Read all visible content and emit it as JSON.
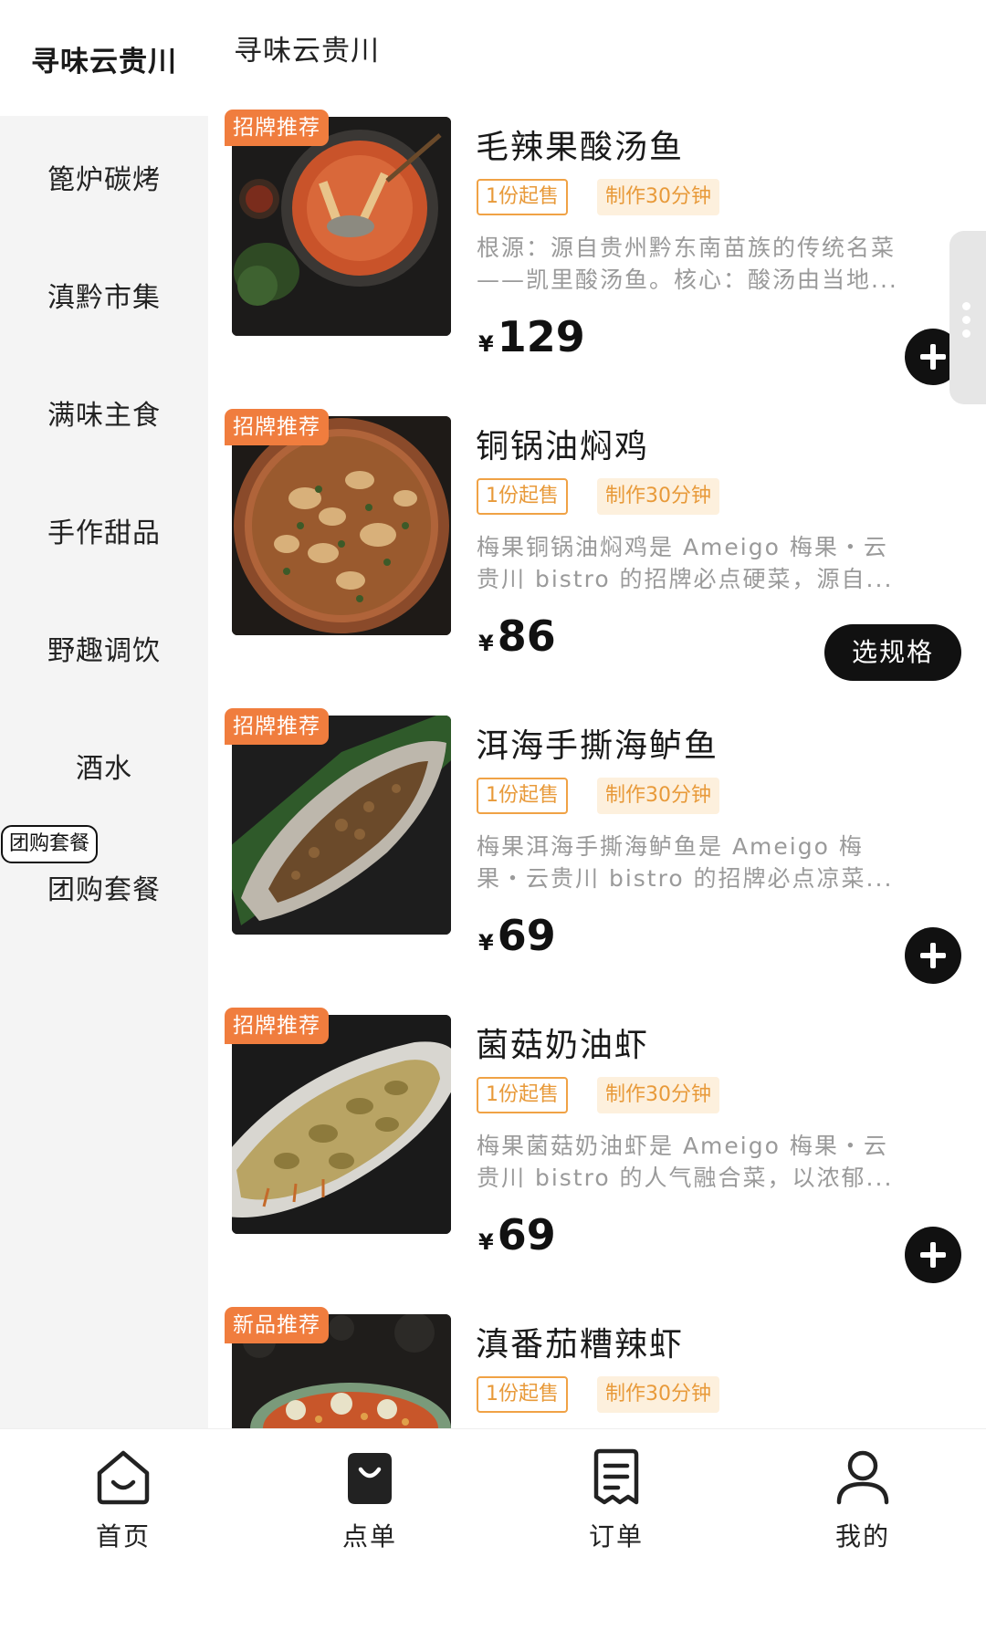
{
  "sidebar": {
    "active_category": "寻味云贵川",
    "categories": [
      "篦炉碳烤",
      "滇黔市集",
      "满味主食",
      "手作甜品",
      "野趣调饮",
      "酒水",
      "团购套餐"
    ],
    "tooltip_label": "团购套餐"
  },
  "section": {
    "title": "寻味云贵川"
  },
  "products": [
    {
      "badge": "招牌推荐",
      "name": "毛辣果酸汤鱼",
      "min_tag": "1份起售",
      "time_tag": "制作30分钟",
      "desc_line1": "根源：源自贵州黔东南苗族的传统名菜",
      "desc_line2": "——凯里酸汤鱼。核心：酸汤由当地...",
      "yen": "¥",
      "price": "129",
      "action": "add"
    },
    {
      "badge": "招牌推荐",
      "name": "铜锅油焖鸡",
      "min_tag": "1份起售",
      "time_tag": "制作30分钟",
      "desc_line1": "梅果铜锅油焖鸡是 Ameigo 梅果・云",
      "desc_line2": "贵川 bistro 的招牌必点硬菜，源自...",
      "yen": "¥",
      "price": "86",
      "action": "spec",
      "spec_label": "选规格"
    },
    {
      "badge": "招牌推荐",
      "name": "洱海手撕海鲈鱼",
      "min_tag": "1份起售",
      "time_tag": "制作30分钟",
      "desc_line1": "梅果洱海手撕海鲈鱼是 Ameigo 梅",
      "desc_line2": "果・云贵川 bistro 的招牌必点凉菜...",
      "yen": "¥",
      "price": "69",
      "action": "add"
    },
    {
      "badge": "招牌推荐",
      "name": "菌菇奶油虾",
      "min_tag": "1份起售",
      "time_tag": "制作30分钟",
      "desc_line1": "梅果菌菇奶油虾是 Ameigo 梅果・云",
      "desc_line2": "贵川 bistro 的人气融合菜，以浓郁...",
      "yen": "¥",
      "price": "69",
      "action": "add"
    },
    {
      "badge": "新品推荐",
      "name": "滇番茄糟辣虾",
      "min_tag": "1份起售",
      "time_tag": "制作30分钟"
    }
  ],
  "tabbar": {
    "home": "首页",
    "order": "点单",
    "orders": "订单",
    "mine": "我的",
    "active": "order"
  },
  "colors": {
    "badge": "#f07d3e",
    "tag_orange": "#e89a3a",
    "tag_bg": "#fdf0dd",
    "button_dark": "#111111",
    "sidebar_bg": "#f4f4f4"
  }
}
